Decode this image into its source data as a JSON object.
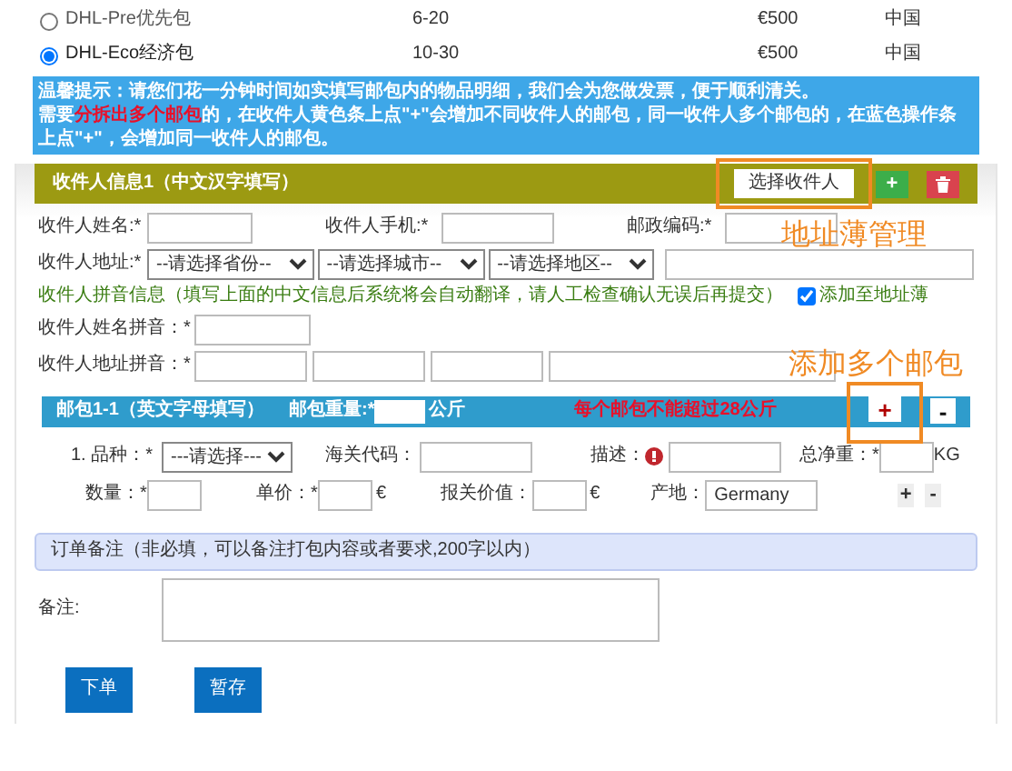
{
  "shipping_options": [
    {
      "name": "DHL-Pre优先包",
      "weight": "6-20",
      "value": "€500",
      "origin": "中国",
      "selected": false
    },
    {
      "name": "DHL-Eco经济包",
      "weight": "10-30",
      "value": "€500",
      "origin": "中国",
      "selected": true
    }
  ],
  "notice": {
    "line1": "温馨提示：请您们花一分钟时间如实填写邮包内的物品明细，我们会为您做发票，便于顺利清关。",
    "line2_before": "需要",
    "line2_highlight": "分拆出多个邮包",
    "line2_after": "的，在收件人黄色条上点\"+\"会增加不同收件人的邮包，同一收件人多个邮包的，在蓝色操作条上点\"+\"，会增加同一收件人的邮包。"
  },
  "recipient": {
    "title": "收件人信息1（中文汉字填写）",
    "select_button": "选择收件人",
    "add_button": "+",
    "name_label": "收件人姓名:*",
    "phone_label": "收件人手机:*",
    "postcode_label": "邮政编码:*",
    "address_label": "收件人地址:*",
    "selects": [
      "--请选择省份--",
      "--请选择城市--",
      "--请选择地区--"
    ],
    "pinyin_note": "收件人拼音信息（填写上面的中文信息后系统将会自动翻译，请人工检查确认无误后再提交）",
    "address_book": {
      "label": "添加至地址薄",
      "checked": true
    },
    "pinyin_name_label": "收件人姓名拼音：*",
    "pinyin_address_label": "收件人地址拼音：*"
  },
  "parcel": {
    "title": "邮包1-1（英文字母填写）",
    "weight_label": "邮包重量:*",
    "weight_unit": "公斤",
    "warning": "每个邮包不能超过28公斤",
    "add_button": "+",
    "remove_button": "-",
    "item": {
      "category_label": "1. 品种：*",
      "category_select": "---请选择---",
      "customs_code_label": "海关代码：",
      "description_label": "描述：",
      "net_weight_label": "总净重：*",
      "net_weight_unit": "KG",
      "quantity_label": "数量：*",
      "unit_price_label": "单价：*",
      "unit_price_currency": "€",
      "declared_value_label": "报关价值：",
      "declared_value_currency": "€",
      "origin_label": "产地：",
      "origin_value": "Germany",
      "add_button": "+",
      "remove_button": "-"
    }
  },
  "remarks": {
    "header": "订单备注（非必填，可以备注打包内容或者要求,200字以内）",
    "label": "备注:"
  },
  "buttons": [
    "下单",
    "暂存"
  ],
  "annotations": [
    "地址薄管理",
    "添加多个邮包"
  ]
}
